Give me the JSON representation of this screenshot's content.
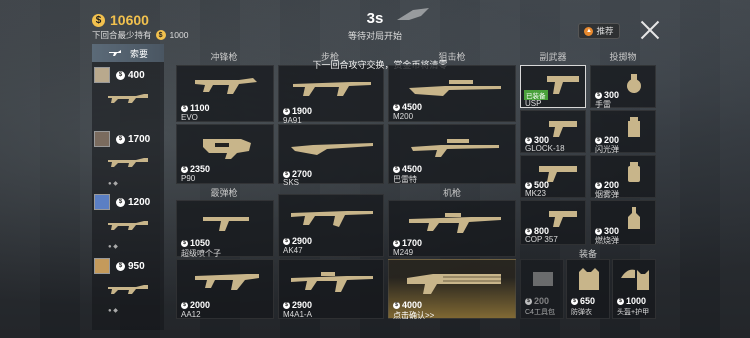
{
  "header": {
    "money": "10600",
    "min_label": "下回合最少持有",
    "min_value": "1000",
    "timer": "3s",
    "timer_sub": "等待对局开始",
    "recommend": "推荐"
  },
  "left": {
    "tab_label": "索要",
    "players": [
      {
        "money": "400"
      },
      {
        "money": "1700"
      },
      {
        "money": "1200"
      },
      {
        "money": "950"
      }
    ]
  },
  "categories": {
    "smg": "冲锋枪",
    "rifle": "步枪",
    "sniper": "狙击枪",
    "pistol": "副武器",
    "throwable": "投掷物",
    "shotgun": "霰弹枪",
    "mg": "机枪",
    "equipment": "装备"
  },
  "notice": "下一回合攻守交换，赏金币将清零",
  "weapons": {
    "evo": {
      "price": "1100",
      "name": "EVO"
    },
    "p90": {
      "price": "2350",
      "name": "P90"
    },
    "9a91": {
      "price": "1900",
      "name": "9A91"
    },
    "sks": {
      "price": "2700",
      "name": "SKS"
    },
    "m200": {
      "price": "4500",
      "name": "M200"
    },
    "barrett": {
      "price": "4500",
      "name": "巴雷特"
    },
    "super_shotgun": {
      "price": "1050",
      "name": "超级喷个子"
    },
    "aa12": {
      "price": "2000",
      "name": "AA12"
    },
    "ak47": {
      "price": "2900",
      "name": "AK47"
    },
    "m4a1": {
      "price": "2900",
      "name": "M4A1-A"
    },
    "m249": {
      "price": "1700",
      "name": "M249"
    },
    "minigun": {
      "price": "4000",
      "name": "点击确认>>"
    },
    "usp": {
      "price": "",
      "name": "USP",
      "badge": "已装备"
    },
    "glock": {
      "price": "300",
      "name": "GLOCK-18"
    },
    "mk23": {
      "price": "500",
      "name": "MK23"
    },
    "cop357": {
      "price": "800",
      "name": "COP 357"
    },
    "grenade": {
      "price": "300",
      "name": "手雷"
    },
    "flash": {
      "price": "200",
      "name": "闪光弹"
    },
    "smoke": {
      "price": "200",
      "name": "烟雾弹"
    },
    "molotov": {
      "price": "300",
      "name": "燃烧弹"
    },
    "c4": {
      "price": "200",
      "name": "C4工具包"
    },
    "vest": {
      "price": "650",
      "name": "防弹衣"
    },
    "helmet": {
      "price": "1000",
      "name": "头盔+护甲"
    }
  },
  "colors": {
    "gold": "#f2c14e",
    "owned": "#4aa13b",
    "weapon": "#c8b58a"
  }
}
